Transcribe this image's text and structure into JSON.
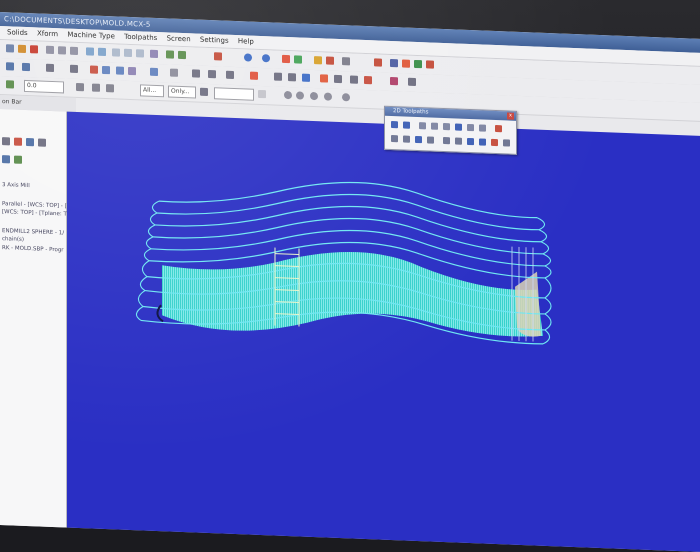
{
  "window": {
    "title": "C:\\DOCUMENTS\\DESKTOP\\MOLD.MCX-5"
  },
  "menu": [
    "Solids",
    "Xform",
    "Machine Type",
    "Toolpaths",
    "Screen",
    "Settings",
    "Help"
  ],
  "toolbar": {
    "z_value": "0.0",
    "all_label": "All...",
    "only_label": "Only...",
    "op_bar_label": "on Bar"
  },
  "toolpaths_window": {
    "title": "2D Toolpaths",
    "close": "x"
  },
  "ops_tree": {
    "lines": [
      "3 Axis Mill",
      "Parallel - [WCS: TOP] - [",
      "[WCS: TOP] - [Tplane: T",
      "ENDMILL2 SPHERE - 1/",
      "chain(s)",
      "RK - MOLD.SBP - Progr"
    ]
  },
  "icons": [
    "wireframe-icon",
    "solid-icon",
    "zoom-icon",
    "pan-icon",
    "rotate-icon",
    "shade-icon",
    "toolpath-icon",
    "verify-icon",
    "backplot-icon",
    "delete-icon"
  ],
  "colors": {
    "viewport_bg": "#2a2fc4",
    "toolpath_line": "#6fe7f2",
    "surface_fill": "#2fd7c9"
  }
}
